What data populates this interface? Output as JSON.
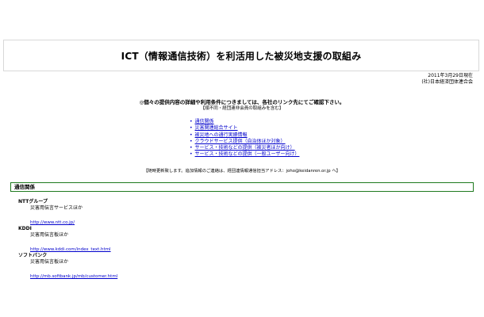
{
  "header": {
    "title": "ICT（情報通信技術）を利活用した被災地支援の取組み",
    "date": "2011年3月29日現在",
    "org": "(社)日本経済団体連合会"
  },
  "notice": {
    "main": "◎個々の提供内容の詳細や利用条件につきましては、各社のリンク先にてご確認下さい。",
    "sub": "【順不同・経団連非会員の取組みを含む】"
  },
  "nav": {
    "items": [
      {
        "label": "通信関係"
      },
      {
        "label": "災害関連総合サイト"
      },
      {
        "label": "被災地への通行実績情報"
      },
      {
        "label": "クラウドサービス提供（自治体ほか対象）"
      },
      {
        "label": "サービス・技術などの提供（被災者ほか向け）"
      },
      {
        "label": "サービス・技術などの提供（一般ユーザー向け）"
      }
    ]
  },
  "update_note": "【随時更新致します。追加情報のご連絡は、経団連情報通信担当アドレス：joho@keidanren.or.jp へ】",
  "section": {
    "title": "通信関係",
    "carriers": [
      {
        "name": "NTTグループ",
        "service": "災害用伝言サービスほか",
        "url": "http://www.ntt.co.jp/"
      },
      {
        "name": "KDDI",
        "service": "災害用伝言板ほか",
        "url": "http://www.kddi.com/index_text.html"
      },
      {
        "name": "ソフトバンク",
        "service": "災害用伝言板ほか",
        "url": "http://mb.softbank.jp/mb/customer.html"
      }
    ]
  },
  "colors": {
    "link": "#0000cc",
    "section_border": "#1e7a1e"
  }
}
